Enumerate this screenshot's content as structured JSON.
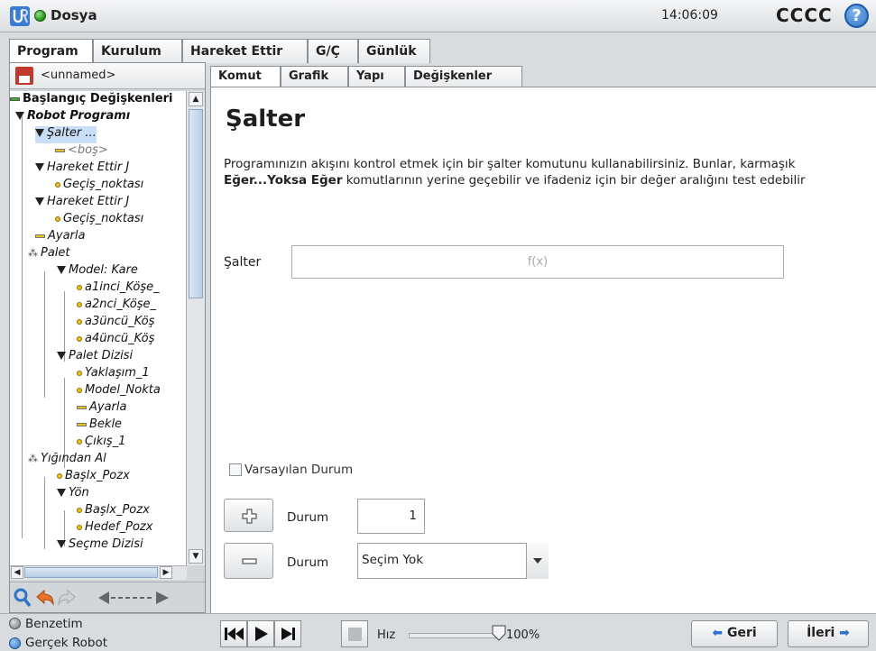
{
  "header": {
    "app_title": "Dosya",
    "clock": "14:06:09",
    "robot_name": "CCCC",
    "help": "?"
  },
  "main_tabs": [
    "Program",
    "Kurulum",
    "Hareket Ettir",
    "G/Ç",
    "Günlük"
  ],
  "left_panel": {
    "file_name": "<unnamed>",
    "tree": [
      {
        "label": "Başlangıç Değişkenleri"
      },
      {
        "label": "Robot Programı"
      },
      {
        "label": "Şalter ..."
      },
      {
        "label": "<boş>"
      },
      {
        "label": "Hareket Ettir J"
      },
      {
        "label": "Geçiş_noktası"
      },
      {
        "label": "Hareket Ettir J"
      },
      {
        "label": "Geçiş_noktası"
      },
      {
        "label": "Ayarla"
      },
      {
        "label": "Palet"
      },
      {
        "label": "Model: Kare"
      },
      {
        "label": "a1inci_Köşe_"
      },
      {
        "label": "a2nci_Köşe_"
      },
      {
        "label": "a3üncü_Köş"
      },
      {
        "label": "a4üncü_Köş"
      },
      {
        "label": "Palet Dizisi"
      },
      {
        "label": "Yaklaşım_1"
      },
      {
        "label": "Model_Nokta"
      },
      {
        "label": "Ayarla"
      },
      {
        "label": "Bekle"
      },
      {
        "label": "Çıkış_1"
      },
      {
        "label": "Yığından Al"
      },
      {
        "label": "Başlx_Pozx"
      },
      {
        "label": "Yön"
      },
      {
        "label": "Başlx_Pozx"
      },
      {
        "label": "Hedef_Pozx"
      },
      {
        "label": "Seçme Dizisi"
      }
    ]
  },
  "sub_tabs": [
    "Komut",
    "Grafik",
    "Yapı",
    "Değişkenler"
  ],
  "command": {
    "title": "Şalter",
    "desc_part1": "Programınızın akışını kontrol etmek için bir şalter komutunu kullanabilirsiniz. Bunlar, karmaşık ",
    "desc_bold": "Eğer...Yoksa Eğer",
    "desc_part2": " komutlarının yerine geçebilir ve ifadeniz için bir değer aralığını test edebilir",
    "switch_label": "Şalter",
    "switch_value": "f(x)",
    "default_case_label": "Varsayılan Durum",
    "case_label": "Durum",
    "case_number": "1",
    "case_select_value": "Seçim Yok"
  },
  "footer": {
    "simulation": "Benzetim",
    "real_robot": "Gerçek Robot",
    "speed_label": "Hız",
    "speed_value": "100%",
    "speed_fraction": 1.0,
    "back": "Geri",
    "next": "İleri"
  },
  "colors": {
    "accent_blue": "#2f74c9",
    "status_green": "#2b9a1c",
    "selection": "#c9dff8"
  }
}
